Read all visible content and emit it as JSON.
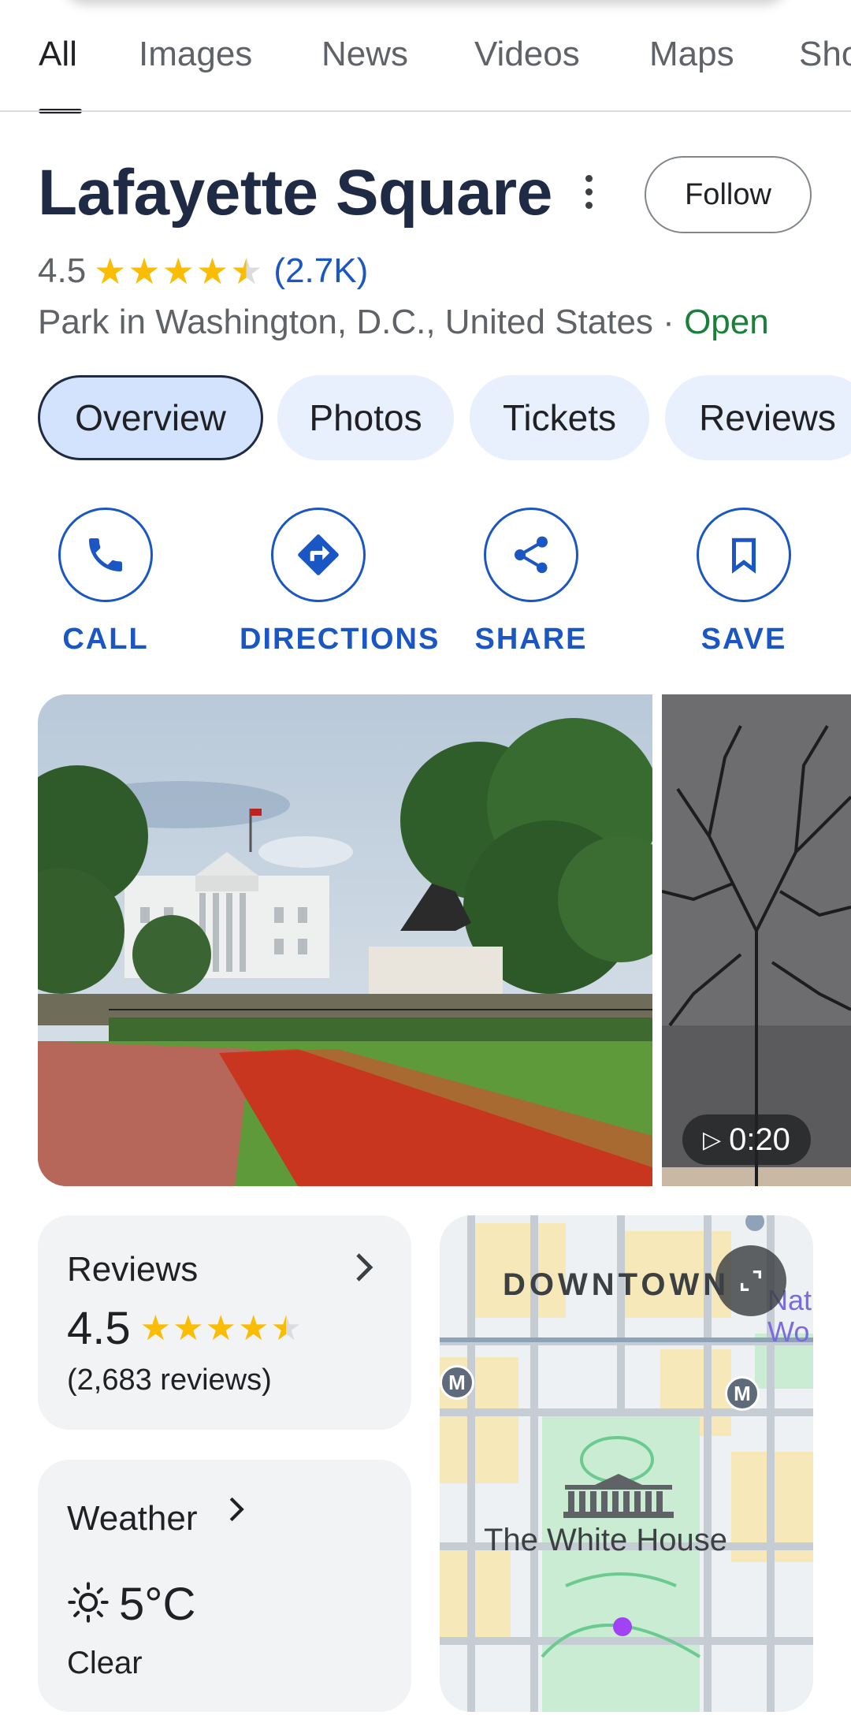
{
  "tabs": [
    "All",
    "Images",
    "News",
    "Videos",
    "Maps",
    "Sho"
  ],
  "place": {
    "title": "Lafayette Square",
    "follow_label": "Follow",
    "rating": "4.5",
    "rating_count": "(2.7K)",
    "category_location": "Park in Washington, D.C., United States",
    "separator": "·",
    "status": "Open"
  },
  "chips": [
    "Overview",
    "Photos",
    "Tickets",
    "Reviews"
  ],
  "actions": [
    {
      "label": "CALL",
      "icon": "phone-icon"
    },
    {
      "label": "DIRECTIONS",
      "icon": "directions-icon"
    },
    {
      "label": "SHARE",
      "icon": "share-icon"
    },
    {
      "label": "SAVE",
      "icon": "bookmark-icon"
    }
  ],
  "video": {
    "duration": "0:20"
  },
  "reviews_card": {
    "title": "Reviews",
    "rating": "4.5",
    "count": "(2,683 reviews)"
  },
  "weather_card": {
    "title": "Weather",
    "temp": "5°C",
    "condition": "Clear",
    "icon": "sun-icon"
  },
  "map": {
    "district": "DOWNTOWN",
    "landmark": "The White House",
    "metro_label": "M",
    "partial_label_1": "Nat",
    "partial_label_2": "Wo"
  },
  "colors": {
    "accent": "#1a56c4",
    "star": "#fbbc04",
    "open": "#188038",
    "chip_bg": "#e8effd",
    "card_bg": "#f1f3f4"
  }
}
